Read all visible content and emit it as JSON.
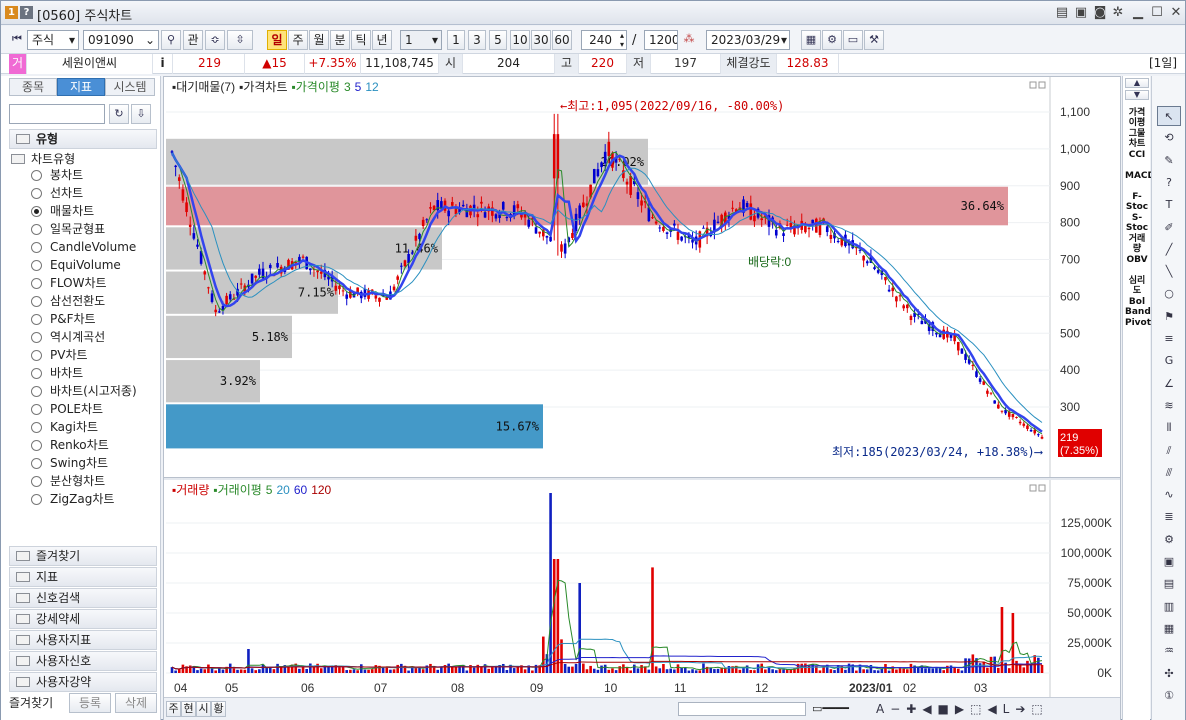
{
  "window": {
    "number_badge": "1",
    "help_badge": "?",
    "title": "[0560] 주식차트"
  },
  "toolbar": {
    "market": "주식",
    "code": "091090",
    "gwan": "관",
    "periods": [
      "일",
      "주",
      "월",
      "분",
      "틱",
      "년"
    ],
    "active_period": "일",
    "interval_select": "1",
    "intervals": [
      "1",
      "3",
      "5",
      "10",
      "30",
      "60"
    ],
    "count": "240",
    "slash": "/",
    "total": "1200",
    "date": "2023/03/29"
  },
  "infobar": {
    "flag": "거",
    "name": "세원이앤씨",
    "i": "i",
    "price": "219",
    "change": "▲15",
    "change_pct": "+7.35%",
    "volume": "11,108,745",
    "open_label": "시",
    "open": "204",
    "high_label": "고",
    "high": "220",
    "low_label": "저",
    "low": "197",
    "strength_label": "체결강도",
    "strength": "128.83",
    "period_badge": "[1일]"
  },
  "left": {
    "tabs": [
      "종목",
      "지표",
      "시스템"
    ],
    "active_tab": "지표",
    "group_type": "유형",
    "subgroup": "차트유형",
    "chart_types": [
      "봉차트",
      "선차트",
      "매물차트",
      "일목균형표",
      "CandleVolume",
      "EquiVolume",
      "FLOW차트",
      "삼선전환도",
      "P&F차트",
      "역시계곡선",
      "PV차트",
      "바차트",
      "바차트(시고저종)",
      "POLE차트",
      "Kagi차트",
      "Renko차트",
      "Swing차트",
      "분산형차트",
      "ZigZag차트"
    ],
    "selected_type": "매물차트",
    "bottom_groups": [
      "즐겨찾기",
      "지표",
      "신호검색",
      "강세약세",
      "사용자지표",
      "사용자신호",
      "사용자강약"
    ],
    "footer": {
      "fav": "즐겨찾기",
      "register": "등록",
      "delete": "삭제"
    }
  },
  "price_legend": {
    "items": [
      {
        "text": "대기매물(7)",
        "color": "#222222"
      },
      {
        "text": "가격차트",
        "color": "#222222"
      },
      {
        "text": "가격이평",
        "color": "#2a8a2a"
      },
      {
        "text": "3",
        "color": "#2a8a2a"
      },
      {
        "text": "5",
        "color": "#2222cc"
      },
      {
        "text": "12",
        "color": "#2a90c0"
      }
    ]
  },
  "annotations": {
    "high": "←최고:1,095(2022/09/16, -80.00%)",
    "low": "최저:185(2023/03/24, +18.38%)⟶",
    "dividend": "배당락:0",
    "last_price": "219",
    "last_pct": "(7.35%)"
  },
  "volume_legend": {
    "items": [
      {
        "text": "거래량",
        "color": "#cc0000"
      },
      {
        "text": "거래이평",
        "color": "#2a8a2a"
      },
      {
        "text": "5",
        "color": "#2a8a2a"
      },
      {
        "text": "20",
        "color": "#2a90c0"
      },
      {
        "text": "60",
        "color": "#2222cc"
      },
      {
        "text": "120",
        "color": "#aa0000"
      }
    ]
  },
  "chart_data": [
    {
      "type": "candlestick",
      "title": "",
      "series": [
        {
          "name": "가격차트",
          "approx_close_path": [
            {
              "x": "2022/04",
              "y": 990
            },
            {
              "x": "2022/05",
              "y": 560
            },
            {
              "x": "2022/05m",
              "y": 660
            },
            {
              "x": "2022/06",
              "y": 700
            },
            {
              "x": "2022/06e",
              "y": 610
            },
            {
              "x": "2022/07",
              "y": 600
            },
            {
              "x": "2022/07e",
              "y": 840
            },
            {
              "x": "2022/08",
              "y": 840
            },
            {
              "x": "2022/08e",
              "y": 830
            },
            {
              "x": "2022/09",
              "y": 720
            },
            {
              "x": "2022/09m",
              "y": 1000
            },
            {
              "x": "2022/10",
              "y": 820
            },
            {
              "x": "2022/10m",
              "y": 740
            },
            {
              "x": "2022/10e",
              "y": 850
            },
            {
              "x": "2022/11",
              "y": 780
            },
            {
              "x": "2022/12",
              "y": 790
            },
            {
              "x": "2022/12e",
              "y": 700
            },
            {
              "x": "2023/01",
              "y": 550
            },
            {
              "x": "2023/02",
              "y": 480
            },
            {
              "x": "2023/03",
              "y": 300
            },
            {
              "x": "2023/03e",
              "y": 219
            }
          ]
        }
      ],
      "volume_profile": [
        {
          "label": "20.02%",
          "price_from": 900,
          "price_to": 1030
        },
        {
          "label": "36.64%",
          "price_from": 790,
          "price_to": 900
        },
        {
          "label": "11.46%",
          "price_from": 670,
          "price_to": 790
        },
        {
          "label": "7.15%",
          "price_from": 550,
          "price_to": 670
        },
        {
          "label": "5.18%",
          "price_from": 430,
          "price_to": 550
        },
        {
          "label": "3.92%",
          "price_from": 310,
          "price_to": 430
        },
        {
          "label": "15.67%",
          "price_from": 185,
          "price_to": 310
        }
      ],
      "yticks": [
        "1,100",
        "1,000",
        "900",
        "800",
        "700",
        "600",
        "500",
        "400",
        "300"
      ],
      "ylim": [
        185,
        1130
      ]
    },
    {
      "type": "bar",
      "title": "",
      "yticks": [
        "125,000K",
        "100,000K",
        "75,000K",
        "50,000K",
        "25,000K",
        "0K"
      ],
      "ylim": [
        0,
        150000
      ],
      "xticks": [
        "04",
        "05",
        "06",
        "07",
        "08",
        "09",
        "10",
        "11",
        "12",
        "2023/01",
        "02",
        "03"
      ]
    }
  ],
  "right_indicators": [
    "가격이평",
    "그물차트",
    "CCI",
    "MACD",
    "F-Stoc",
    "S-Stoc",
    "거래량",
    "OBV",
    "심리도",
    "Bol Band",
    "Pivot"
  ],
  "statusbar": {
    "tabs": [
      "주",
      "현",
      "시",
      "황"
    ]
  }
}
